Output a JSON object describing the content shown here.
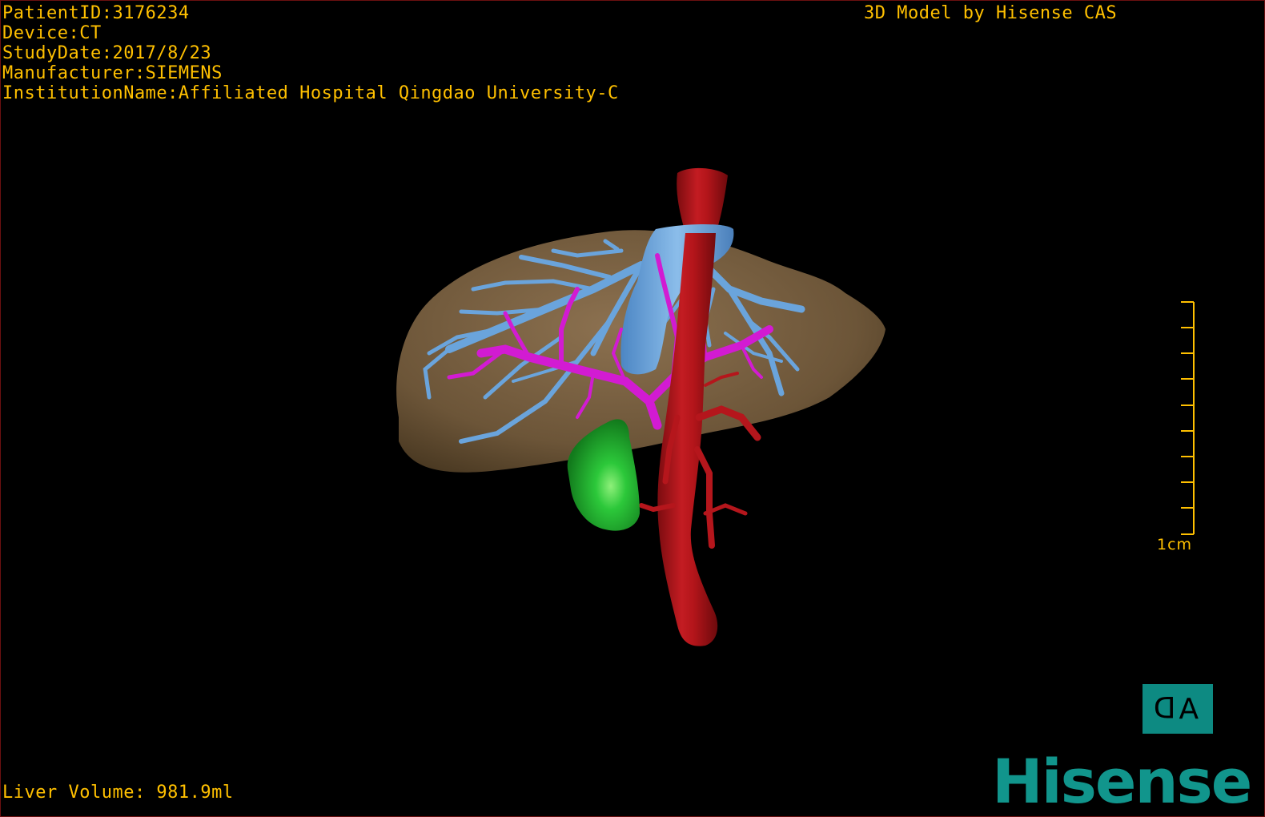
{
  "overlay": {
    "patient_id": "PatientID:3176234",
    "device": "Device:CT",
    "study_date": "StudyDate:2017/8/23",
    "manufacturer": "Manufacturer:SIEMENS",
    "institution": "InstitutionName:Affiliated Hospital Qingdao University-C",
    "watermark": "3D Model by Hisense CAS",
    "liver_volume": "Liver Volume: 981.9ml"
  },
  "scale": {
    "label": "1cm",
    "ticks": 10
  },
  "orientation": {
    "left": "ᗡ",
    "right": "A",
    "icon": "orientation-cube-icon"
  },
  "brand": {
    "logo_text": "Hisense"
  },
  "colors": {
    "text": "#ffc000",
    "liver": "#7a6244",
    "hepatic_vein": "#6aa4dc",
    "portal_vein": "#d21bd2",
    "aorta": "#b5161c",
    "gallbladder": "#1fb32c",
    "brand": "#11958c"
  }
}
